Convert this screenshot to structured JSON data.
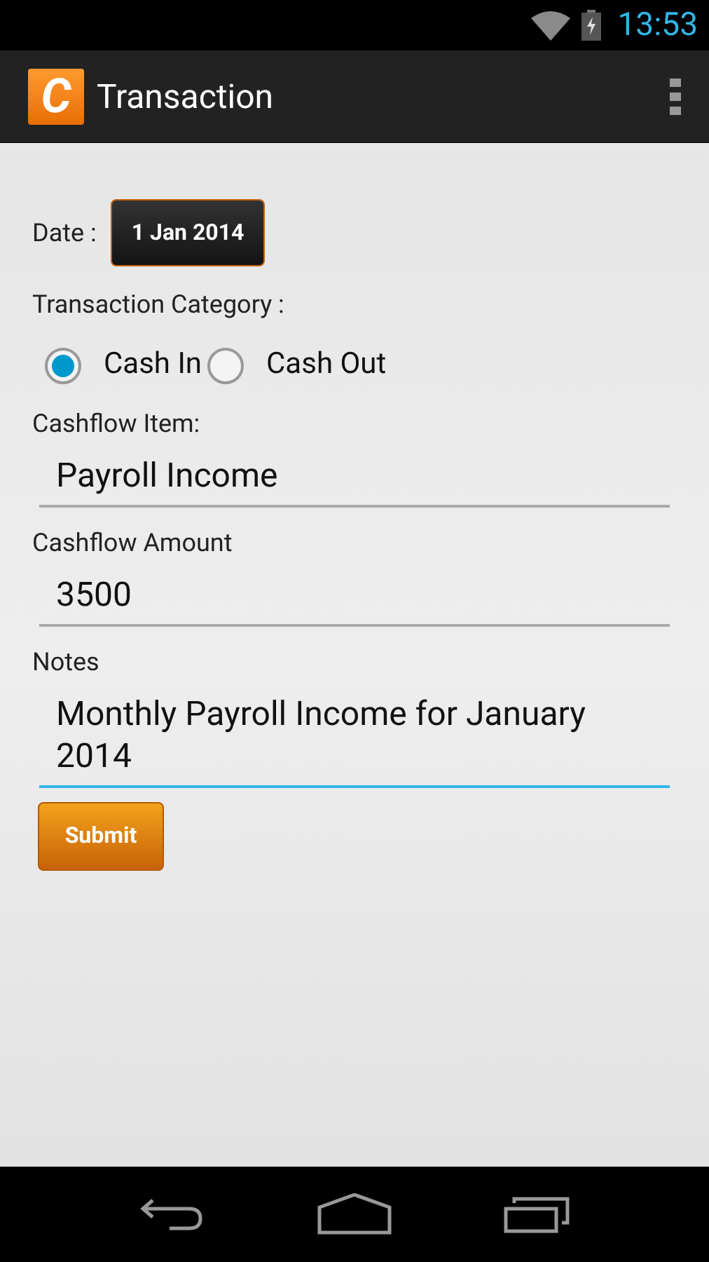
{
  "status_bar": {
    "time": "13:53"
  },
  "app_bar": {
    "logo_letter": "C",
    "title": "Transaction"
  },
  "date": {
    "label": "Date :",
    "value": "1 Jan 2014"
  },
  "category": {
    "label": "Transaction Category :",
    "options": [
      {
        "label": "Cash In",
        "selected": true
      },
      {
        "label": "Cash Out",
        "selected": false
      }
    ]
  },
  "fields": [
    {
      "label": "Cashflow Item:",
      "value": "Payroll Income",
      "focused": false
    },
    {
      "label": "Cashflow Amount",
      "value": "3500",
      "focused": false
    },
    {
      "label": "Notes",
      "value": "Monthly Payroll Income for January 2014",
      "focused": true
    }
  ],
  "submit": "Submit"
}
